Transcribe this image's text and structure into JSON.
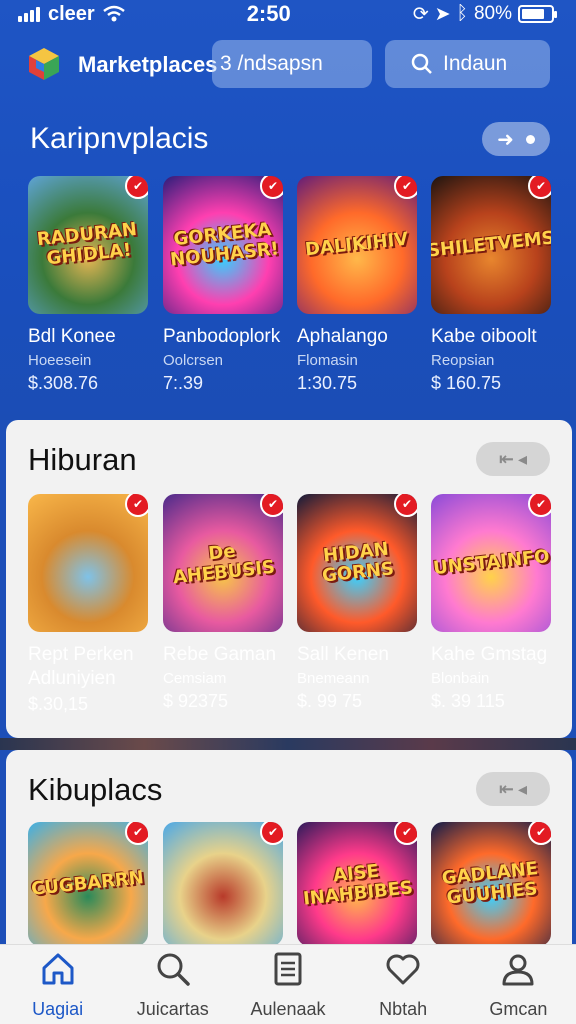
{
  "status": {
    "carrier": "cleer",
    "time": "2:50",
    "battery": "80%",
    "battery_level": 0.8
  },
  "header": {
    "app_title": "Marketplaces",
    "tab_label": "3 /ndsapsn",
    "search_label": "Indaun"
  },
  "section1": {
    "title": "Karipnvplacis",
    "items": [
      {
        "thumb_title": "RADURAN GHIDLA!",
        "name": "Bdl Konee",
        "sub": "Hoeesein",
        "price": "$.308.76",
        "colors": [
          "#5fa4d8",
          "#3b7a3a",
          "#e4b553"
        ]
      },
      {
        "thumb_title": "GORKEKA NOUHASR!",
        "name": "Panbodoplork",
        "sub": "Oolcrsen",
        "price": "7:.39",
        "colors": [
          "#2a1d7a",
          "#ff3fb0",
          "#33d1ff"
        ]
      },
      {
        "thumb_title": "DALIKIHIV",
        "name": "Aphalango",
        "sub": "Flomasin",
        "price": "1:30.75",
        "colors": [
          "#611c7a",
          "#ff6a2a",
          "#ffb84a"
        ]
      },
      {
        "thumb_title": "SHILETVEMS",
        "name": "Kabe oiboolt",
        "sub": "Reopsian",
        "price": "$ 160.75",
        "colors": [
          "#1c1410",
          "#b8421c",
          "#e8862e"
        ]
      }
    ]
  },
  "section2": {
    "title": "Hiburan",
    "items": [
      {
        "thumb_title": "",
        "name": "Rept Perken",
        "name2": "Adluniyien",
        "sub": "",
        "price": "$.30,15",
        "colors": [
          "#f9b74a",
          "#d98a2e",
          "#7fc2e8"
        ]
      },
      {
        "thumb_title": "De AHEBUSIS",
        "name": "Rebe Gaman",
        "sub": "Cemsiam",
        "price": "$ 92375",
        "colors": [
          "#4a2a8a",
          "#e85aa0",
          "#f7c548"
        ]
      },
      {
        "thumb_title": "HIDAN GORNS",
        "name": "Sall Kenen",
        "sub": "Bnemeann",
        "price": "$. 99 75",
        "colors": [
          "#101a3a",
          "#ff5a2a",
          "#3ad0ff"
        ]
      },
      {
        "thumb_title": "UNSTAINFO",
        "name": "Kahe Gmstag",
        "sub": "Blonbain",
        "price": "$. 39 115",
        "colors": [
          "#8a4ad8",
          "#ff7ad0",
          "#ffd24a"
        ]
      }
    ]
  },
  "section3": {
    "title": "Kibuplacs",
    "items": [
      {
        "thumb_title": "CUGBARRN",
        "colors": [
          "#3ab0e8",
          "#f7a84a",
          "#2a8a5a"
        ]
      },
      {
        "thumb_title": "",
        "colors": [
          "#4aa8e8",
          "#e8d28a",
          "#b83a2a"
        ]
      },
      {
        "thumb_title": "AISE INAHBIBES",
        "colors": [
          "#2a1a5a",
          "#ff3a8a",
          "#ffb84a"
        ]
      },
      {
        "thumb_title": "GADLANE GUUHIES",
        "colors": [
          "#0c1a4a",
          "#ff6a2a",
          "#3ad0ff"
        ]
      }
    ]
  },
  "nav": [
    {
      "label": "Uagiai",
      "icon": "home-icon",
      "active": true
    },
    {
      "label": "Juicartas",
      "icon": "search-icon",
      "active": false
    },
    {
      "label": "Aulenaak",
      "icon": "list-icon",
      "active": false
    },
    {
      "label": "Nbtah",
      "icon": "heart-icon",
      "active": false
    },
    {
      "label": "Gmcan",
      "icon": "profile-icon",
      "active": false
    }
  ]
}
